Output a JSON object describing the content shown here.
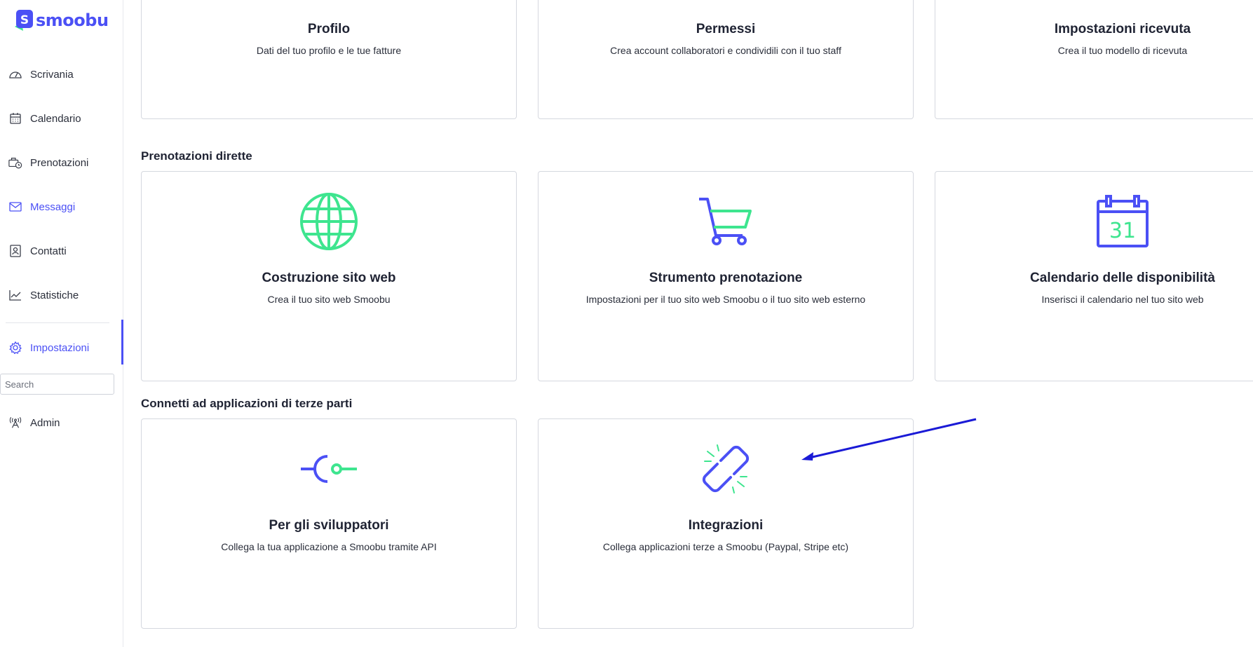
{
  "brand": {
    "name": "smoobu"
  },
  "sidebar": {
    "items": [
      {
        "label": "Scrivania",
        "icon": "dashboard-icon"
      },
      {
        "label": "Calendario",
        "icon": "calendar-icon"
      },
      {
        "label": "Prenotazioni",
        "icon": "bookings-icon"
      },
      {
        "label": "Messaggi",
        "icon": "mail-icon"
      },
      {
        "label": "Contatti",
        "icon": "contacts-icon"
      },
      {
        "label": "Statistiche",
        "icon": "stats-icon"
      },
      {
        "label": "Impostazioni",
        "icon": "gear-icon"
      }
    ],
    "search_placeholder": "Search",
    "admin_label": "Admin"
  },
  "top_cards": [
    {
      "title": "Profilo",
      "desc": "Dati del tuo profilo e le tue fatture"
    },
    {
      "title": "Permessi",
      "desc": "Crea account collaboratori e condividili con il tuo staff"
    },
    {
      "title": "Impostazioni ricevuta",
      "desc": "Crea il tuo modello di ricevuta"
    }
  ],
  "direct": {
    "section_title": "Prenotazioni dirette",
    "cards": [
      {
        "title": "Costruzione sito web",
        "desc": "Crea il tuo sito web Smoobu",
        "icon": "globe-icon"
      },
      {
        "title": "Strumento prenotazione",
        "desc": "Impostazioni per il tuo sito web Smoobu o il tuo sito web esterno",
        "icon": "cart-icon"
      },
      {
        "title": "Calendario delle disponibilità",
        "desc": "Inserisci il calendario nel tuo sito web",
        "icon": "calendar-31-icon",
        "icon_text": "31"
      }
    ]
  },
  "third_party": {
    "section_title": "Connetti ad applicazioni di terze parti",
    "cards": [
      {
        "title": "Per gli sviluppatori",
        "desc": "Collega la tua applicazione a Smoobu tramite API",
        "icon": "api-plug-icon"
      },
      {
        "title": "Integrazioni",
        "desc": "Collega applicazioni terze a Smoobu (Paypal, Stripe etc)",
        "icon": "broken-link-icon"
      }
    ]
  },
  "colors": {
    "brand_blue": "#4b50f5",
    "brand_green": "#3ee58f",
    "arrow_blue": "#1a1ad6"
  }
}
